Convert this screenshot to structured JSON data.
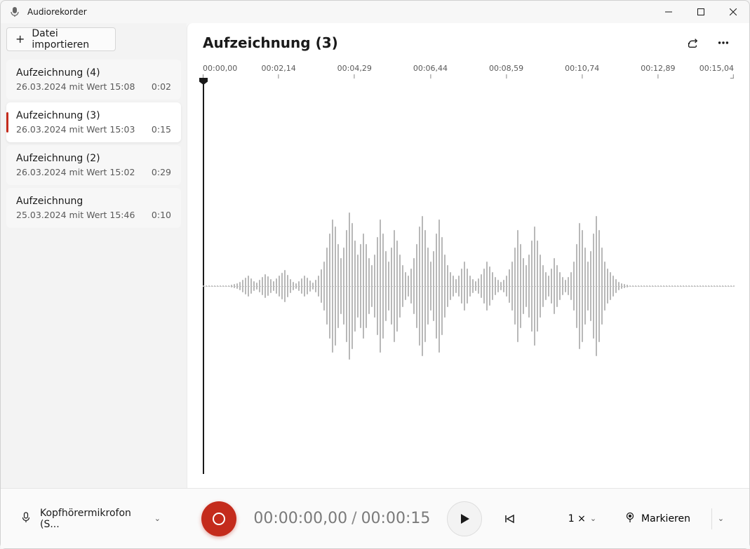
{
  "app": {
    "title": "Audiorekorder"
  },
  "sidebar": {
    "import_label": "Datei importieren",
    "recordings": [
      {
        "title": "Aufzeichnung (4)",
        "meta": "26.03.2024 mit Wert 15:08",
        "duration": "0:02",
        "selected": false
      },
      {
        "title": "Aufzeichnung (3)",
        "meta": "26.03.2024 mit Wert 15:03",
        "duration": "0:15",
        "selected": true
      },
      {
        "title": "Aufzeichnung (2)",
        "meta": "26.03.2024 mit Wert 15:02",
        "duration": "0:29",
        "selected": false
      },
      {
        "title": "Aufzeichnung",
        "meta": "25.03.2024 mit Wert 15:46",
        "duration": "0:10",
        "selected": false
      }
    ]
  },
  "main": {
    "title": "Aufzeichnung (3)",
    "ruler": [
      "00:00,00",
      "00:02,14",
      "00:04,29",
      "00:06,44",
      "00:08,59",
      "00:10,74",
      "00:12,89",
      "00:15,04"
    ]
  },
  "controls": {
    "mic_label": "Kopfhörermikrofon (S...",
    "current_time": "00:00:00,00",
    "total_time": "00:00:15",
    "speed": "1 ×",
    "mark_label": "Markieren"
  },
  "waveform_heights": [
    2,
    2,
    2,
    2,
    2,
    2,
    2,
    2,
    2,
    2,
    4,
    6,
    8,
    12,
    18,
    24,
    30,
    22,
    14,
    10,
    18,
    26,
    34,
    28,
    20,
    14,
    22,
    30,
    38,
    46,
    32,
    20,
    12,
    8,
    14,
    22,
    30,
    24,
    16,
    10,
    18,
    30,
    48,
    70,
    110,
    150,
    190,
    170,
    120,
    80,
    110,
    160,
    210,
    180,
    130,
    90,
    120,
    150,
    120,
    80,
    60,
    90,
    140,
    190,
    150,
    100,
    70,
    110,
    160,
    130,
    90,
    60,
    40,
    30,
    50,
    80,
    120,
    170,
    200,
    160,
    110,
    70,
    100,
    150,
    190,
    140,
    90,
    60,
    40,
    30,
    20,
    30,
    50,
    70,
    50,
    30,
    20,
    14,
    22,
    34,
    50,
    70,
    56,
    40,
    26,
    18,
    12,
    18,
    30,
    48,
    70,
    110,
    160,
    120,
    80,
    60,
    90,
    130,
    170,
    130,
    90,
    60,
    40,
    30,
    50,
    80,
    60,
    40,
    26,
    18,
    26,
    40,
    70,
    120,
    180,
    160,
    110,
    70,
    100,
    150,
    200,
    160,
    110,
    70,
    50,
    40,
    30,
    20,
    12,
    8,
    6,
    4,
    2,
    2,
    2,
    2,
    2,
    2,
    2,
    2,
    2,
    2,
    2,
    2,
    2,
    2,
    2,
    2,
    2,
    2,
    2,
    2,
    2,
    2,
    2,
    2,
    2,
    2,
    2,
    2,
    2,
    2,
    2,
    2,
    2,
    2,
    2,
    2,
    2,
    2
  ]
}
